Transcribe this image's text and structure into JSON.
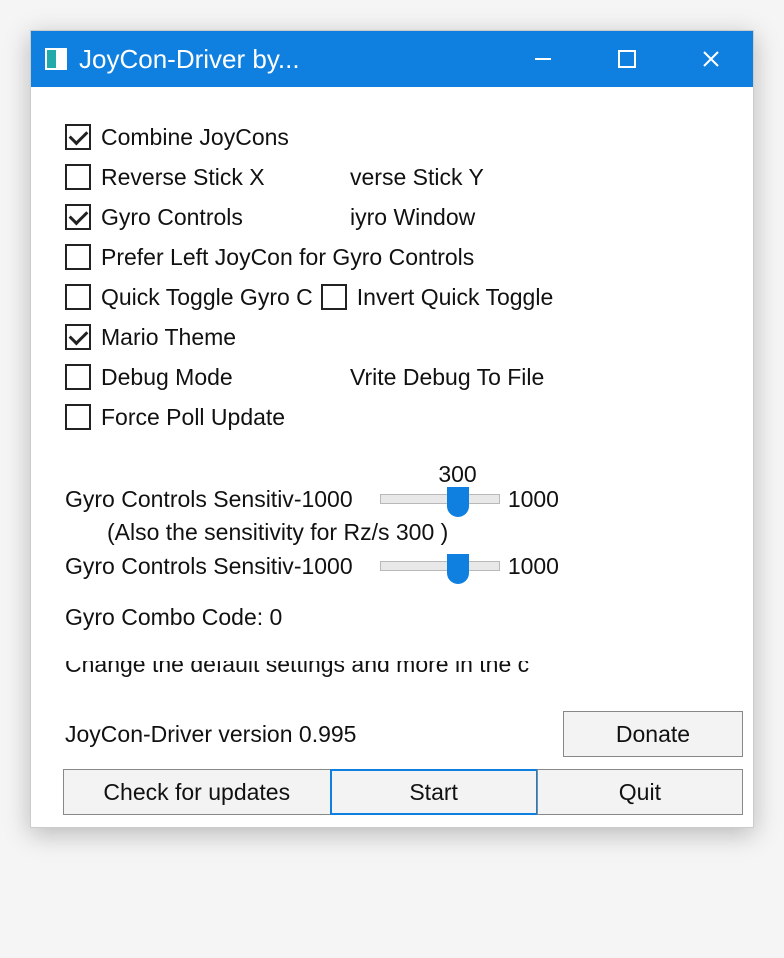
{
  "window": {
    "title": "JoyCon-Driver by..."
  },
  "checkboxes": {
    "combine": {
      "label": "Combine JoyCons",
      "checked": true
    },
    "revx": {
      "label": "Reverse Stick X",
      "checked": false
    },
    "revy": {
      "label": "verse Stick Y",
      "checked": false
    },
    "gyro": {
      "label": "Gyro Controls",
      "checked": true
    },
    "gyrowin": {
      "label": "iyro Window",
      "checked": false
    },
    "preferleft": {
      "label": "Prefer Left JoyCon for Gyro Controls",
      "checked": false
    },
    "quicktoggle": {
      "label": "Quick Toggle Gyro C",
      "checked": false
    },
    "invertquick": {
      "label": "Invert Quick Toggle",
      "checked": false
    },
    "mario": {
      "label": "Mario Theme",
      "checked": true
    },
    "debug": {
      "label": "Debug Mode",
      "checked": false
    },
    "debugfile": {
      "label": "Vrite Debug To File",
      "checked": false
    },
    "forcepoll": {
      "label": "Force Poll Update",
      "checked": false
    }
  },
  "sliders": {
    "s1": {
      "label": "Gyro Controls Sensitiv",
      "min": "-1000",
      "max": "1000",
      "value": "300",
      "pos_pct": 65
    },
    "note": "(Also the sensitivity for Rz/s 300  )",
    "s2": {
      "label": "Gyro Controls Sensitiv",
      "min": "-1000",
      "max": "1000",
      "value": "",
      "pos_pct": 65
    }
  },
  "combo": "Gyro Combo Code: 0",
  "cutoff_text": "Change the default settings and more in the c",
  "version": "JoyCon-Driver version 0.995",
  "buttons": {
    "donate": "Donate",
    "check": "Check for updates",
    "start": "Start",
    "quit": "Quit"
  }
}
